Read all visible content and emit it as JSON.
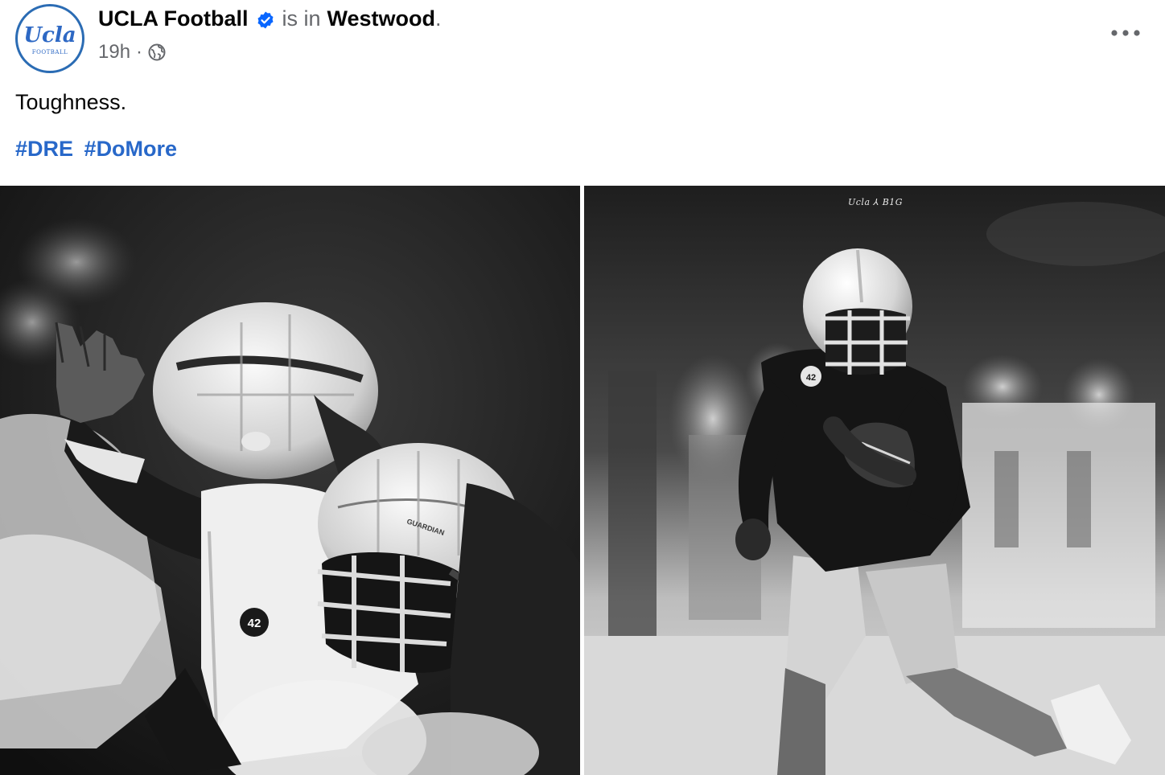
{
  "post": {
    "page_name": "UCLA Football",
    "is_in_text": "is in",
    "location": "Westwood",
    "location_suffix": ".",
    "time_ago": "19h",
    "time_separator": "·",
    "audience_icon": "globe-icon",
    "verified_icon": "verified-badge-icon",
    "more_icon": "more-options-icon",
    "caption": "Toughness.",
    "hashtags": [
      "#DRE",
      "#DoMore"
    ]
  },
  "avatar": {
    "logo_text": "Ucla",
    "logo_subtext": "FOOTBALL"
  },
  "photos": [
    {
      "description": "black-and-white football practice photo of a player in a padded helmet, number 42",
      "jersey_number": "42",
      "helmet_text": "GUARDIAN"
    },
    {
      "description": "black-and-white photo of a player running with the football, number 42",
      "jersey_number": "42",
      "watermark": "Ucla ⅄ B1G"
    }
  ],
  "colors": {
    "link": "#2868c9",
    "secondary_text": "#65676b",
    "verified": "#0866ff",
    "avatar_brand": "#2d68c4"
  }
}
